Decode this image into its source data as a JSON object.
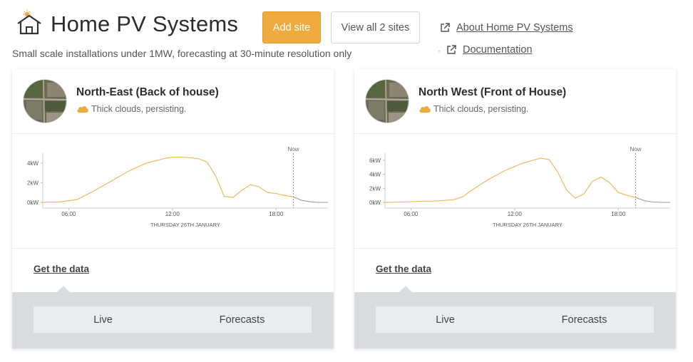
{
  "header": {
    "title": "Home PV Systems",
    "subtitle": "Small scale installations under 1MW, forecasting at 30-minute resolution only",
    "add_site_label": "Add site",
    "view_all_label": "View all 2 sites",
    "about_link": "About Home PV Systems",
    "docs_link": "Documentation",
    "bullet": "·"
  },
  "colors": {
    "accent": "#efab3f",
    "line": "#efb251",
    "past_line": "#999999",
    "panel": "#d8dce0"
  },
  "sites": [
    {
      "name": "North-East (Back of house)",
      "weather": "Thick clouds, persisting.",
      "weather_icon": "cloud-icon",
      "get_data": "Get the data",
      "tabs": [
        "Live",
        "Forecasts"
      ],
      "chart_data": {
        "type": "line",
        "now_label": "Now",
        "date_label": "THURSDAY 26TH JANUARY",
        "x_ticks": [
          "06:00",
          "12:00",
          "18:00"
        ],
        "y_ticks": [
          "4kW",
          "2kW",
          "0kW"
        ],
        "ylim": [
          0,
          5
        ],
        "xlim": [
          4.5,
          21
        ],
        "now": 19,
        "series": [
          {
            "x": [
              4.5,
              5.5,
              6.5,
              7.5,
              8.5,
              9.5,
              10.5,
              11.5,
              12.0,
              12.5,
              13.0,
              13.5,
              14.0,
              14.5,
              15.0,
              15.5,
              16.0,
              16.5,
              17.0,
              17.5,
              18.0,
              18.5,
              19.0
            ],
            "y": [
              0.0,
              0.05,
              0.3,
              1.2,
              2.2,
              3.2,
              4.0,
              4.45,
              4.6,
              4.6,
              4.55,
              4.45,
              4.1,
              2.7,
              0.6,
              0.5,
              1.2,
              1.8,
              1.6,
              1.0,
              0.9,
              0.7,
              0.55
            ]
          },
          {
            "x": [
              19.0,
              19.5,
              20.0,
              20.5,
              21.0
            ],
            "y": [
              0.55,
              0.2,
              0.05,
              0.0,
              0.0
            ]
          }
        ]
      }
    },
    {
      "name": "North West (Front of House)",
      "weather": "Thick clouds, persisting.",
      "weather_icon": "cloud-icon",
      "get_data": "Get the data",
      "tabs": [
        "Live",
        "Forecasts"
      ],
      "chart_data": {
        "type": "line",
        "now_label": "Now",
        "date_label": "THURSDAY 26TH JANUARY",
        "x_ticks": [
          "06:00",
          "12:00",
          "18:00"
        ],
        "y_ticks": [
          "6kW",
          "4kW",
          "2kW",
          "0kW"
        ],
        "ylim": [
          0,
          7
        ],
        "xlim": [
          4.5,
          21
        ],
        "now": 19,
        "series": [
          {
            "x": [
              4.5,
              5.5,
              6.5,
              7.5,
              8.5,
              9.0,
              9.5,
              10.5,
              11.5,
              12.5,
              13.5,
              14.0,
              14.5,
              15.0,
              15.5,
              16.0,
              16.5,
              17.0,
              17.5,
              18.0,
              18.5,
              19.0
            ],
            "y": [
              0.0,
              0.05,
              0.15,
              0.2,
              0.4,
              0.8,
              1.7,
              3.3,
              4.6,
              5.6,
              6.3,
              6.1,
              4.3,
              1.8,
              0.6,
              1.2,
              3.0,
              3.6,
              2.8,
              1.4,
              1.0,
              0.7
            ]
          },
          {
            "x": [
              19.0,
              19.5,
              20.0,
              20.5,
              21.0
            ],
            "y": [
              0.7,
              0.25,
              0.05,
              0.0,
              0.0
            ]
          }
        ]
      }
    }
  ]
}
